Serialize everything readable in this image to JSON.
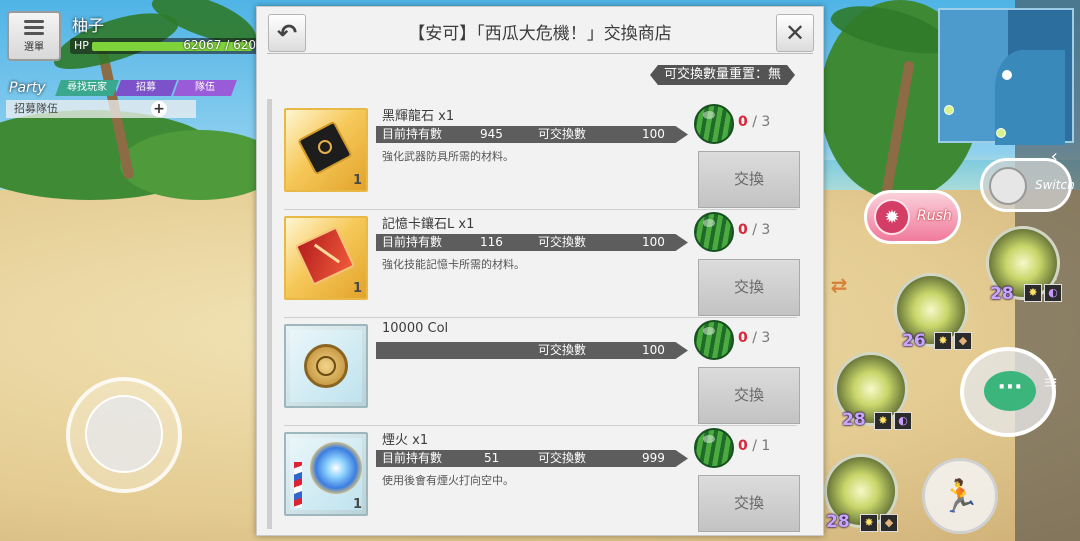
{
  "colors": {
    "accent_red": "#d6283b",
    "hp_green": "#7fd33a",
    "rush_pink": "#f07a9b",
    "dialog_bg": "#f2f2f2"
  },
  "hud": {
    "menu_label": "選單",
    "player_name": "柚子",
    "hp_label": "HP",
    "hp_value": "62067 / 620",
    "party_label": "Party",
    "party_tabs": [
      "尋找玩家",
      "招募",
      "隊伍"
    ],
    "party_member": "招募隊伍",
    "party_add_icon": "+",
    "rush_label": "Rush",
    "switch_label": "Switch",
    "skill_levels": [
      "28",
      "26",
      "28",
      "28"
    ],
    "icons": [
      "menu-icon",
      "joystick",
      "minimap",
      "rush-icon",
      "switch-icon",
      "chat-icon",
      "sprint-icon",
      "swap-icon",
      "back-nav-icon",
      "home-icon",
      "overflow-icon"
    ]
  },
  "shop": {
    "title": "【安可】「西瓜大危機！」交換商店",
    "back_icon": "↶",
    "close_icon": "✕",
    "reset_text": "可交換數量重置：無",
    "owned_label": "目前持有數",
    "exchangeable_label": "可交換數",
    "exchange_button": "交換",
    "items": [
      {
        "name": "黑輝龍石 x1",
        "owned": "945",
        "exchangeable": "100",
        "limit_used": "0",
        "limit_total": "/ 3",
        "desc": "強化武器防具所需的材料。",
        "icon_count": "1",
        "icon": "black-dragon-stone-icon"
      },
      {
        "name": "記憶卡鑲石L x1",
        "owned": "116",
        "exchangeable": "100",
        "limit_used": "0",
        "limit_total": "/ 3",
        "desc": "強化技能記憶卡所需的材料。",
        "icon_count": "1",
        "icon": "memory-card-stone-icon"
      },
      {
        "name": "10000 Col",
        "owned": "",
        "exchangeable": "100",
        "limit_used": "0",
        "limit_total": "/ 3",
        "desc": "",
        "icon_count": "",
        "icon": "col-coin-icon"
      },
      {
        "name": "煙火 x1",
        "owned": "51",
        "exchangeable": "999",
        "limit_used": "0",
        "limit_total": "/ 1",
        "desc": "使用後會有煙火打向空中。",
        "icon_count": "1",
        "icon": "fireworks-icon"
      }
    ]
  }
}
